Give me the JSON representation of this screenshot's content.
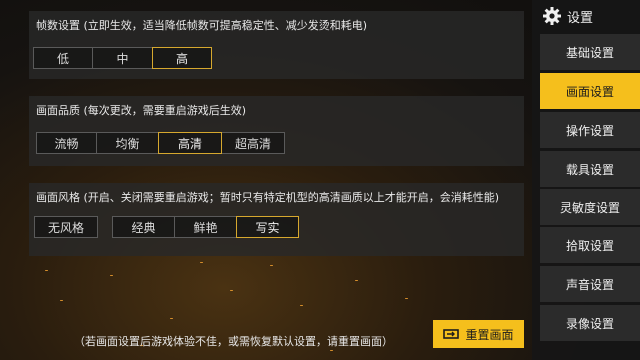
{
  "framerate": {
    "title": "帧数设置 (立即生效，适当降低帧数可提高稳定性、减少发烫和耗电)",
    "options": [
      "低",
      "中",
      "高"
    ],
    "selected": "高"
  },
  "quality": {
    "title": "画面品质 (每次更改，需要重启游戏后生效)",
    "options": [
      "流畅",
      "均衡",
      "高清",
      "超高清"
    ],
    "selected": "高清"
  },
  "style": {
    "title": "画面风格 (开启、关闭需要重启游戏；暂时只有特定机型的高清画质以上才能开启，会消耗性能)",
    "none_label": "无风格",
    "options": [
      "经典",
      "鲜艳",
      "写实"
    ],
    "selected": "写实"
  },
  "sidebar": {
    "header": "设置",
    "items": [
      {
        "label": "基础设置"
      },
      {
        "label": "画面设置"
      },
      {
        "label": "操作设置"
      },
      {
        "label": "载具设置"
      },
      {
        "label": "灵敏度设置"
      },
      {
        "label": "拾取设置"
      },
      {
        "label": "声音设置"
      },
      {
        "label": "录像设置"
      }
    ],
    "active": "画面设置"
  },
  "footer": {
    "note": "（若画面设置后游戏体验不佳，或需恢复默认设置，请重置画面）",
    "reset_label": "重置画面"
  },
  "colors": {
    "accent": "#f5bf1c",
    "selected_border": "#d6a82e"
  }
}
